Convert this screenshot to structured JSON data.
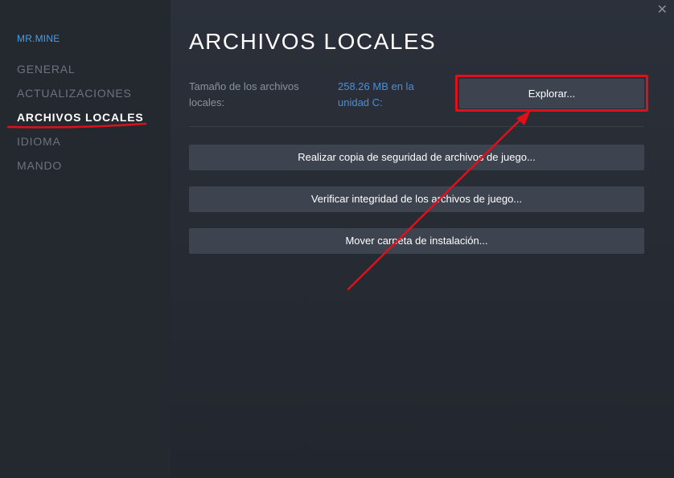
{
  "sidebar": {
    "game_name": "MR.MINE",
    "items": [
      {
        "label": "GENERAL"
      },
      {
        "label": "ACTUALIZACIONES"
      },
      {
        "label": "ARCHIVOS LOCALES"
      },
      {
        "label": "IDIOMA"
      },
      {
        "label": "MANDO"
      }
    ],
    "active_item": "ARCHIVOS LOCALES"
  },
  "window": {
    "close_glyph": "✕"
  },
  "main": {
    "title": "ARCHIVOS LOCALES",
    "size_label": "Tamaño de los archivos locales:",
    "size_value": "258.26 MB en la unidad C:",
    "explore_button": "Explorar...",
    "buttons": [
      {
        "label": "Realizar copia de seguridad de archivos de juego..."
      },
      {
        "label": "Verificar integridad de los archivos de juego..."
      },
      {
        "label": "Mover carpeta de instalación..."
      }
    ]
  },
  "colors": {
    "accent_blue": "#4a9de0",
    "annotation_red": "#e0101a",
    "sidebar_bg": "#24282f",
    "button_bg": "#3d4450"
  },
  "icons": {
    "close": "close-icon"
  }
}
